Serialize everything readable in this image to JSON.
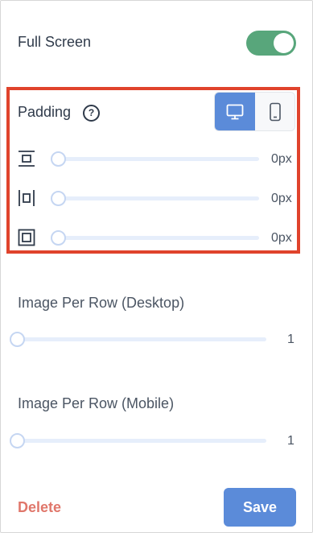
{
  "full_screen": {
    "label": "Full Screen",
    "enabled": true
  },
  "padding": {
    "label": "Padding",
    "help_icon": "?",
    "device_buttons": [
      {
        "name": "desktop-icon",
        "selected": true
      },
      {
        "name": "mobile-icon",
        "selected": false
      }
    ],
    "rows": [
      {
        "icon": "padding-vertical-icon",
        "value": "0px"
      },
      {
        "icon": "padding-horizontal-icon",
        "value": "0px"
      },
      {
        "icon": "padding-all-icon",
        "value": "0px"
      }
    ]
  },
  "image_per_row_desktop": {
    "label": "Image Per Row (Desktop)",
    "value": "1"
  },
  "image_per_row_mobile": {
    "label": "Image Per Row (Mobile)",
    "value": "1"
  },
  "footer": {
    "delete_label": "Delete",
    "save_label": "Save"
  },
  "colors": {
    "accent": "#5b8bd9",
    "toggle_on": "#58a67b",
    "delete": "#e0776b",
    "highlight": "#e0432c"
  }
}
